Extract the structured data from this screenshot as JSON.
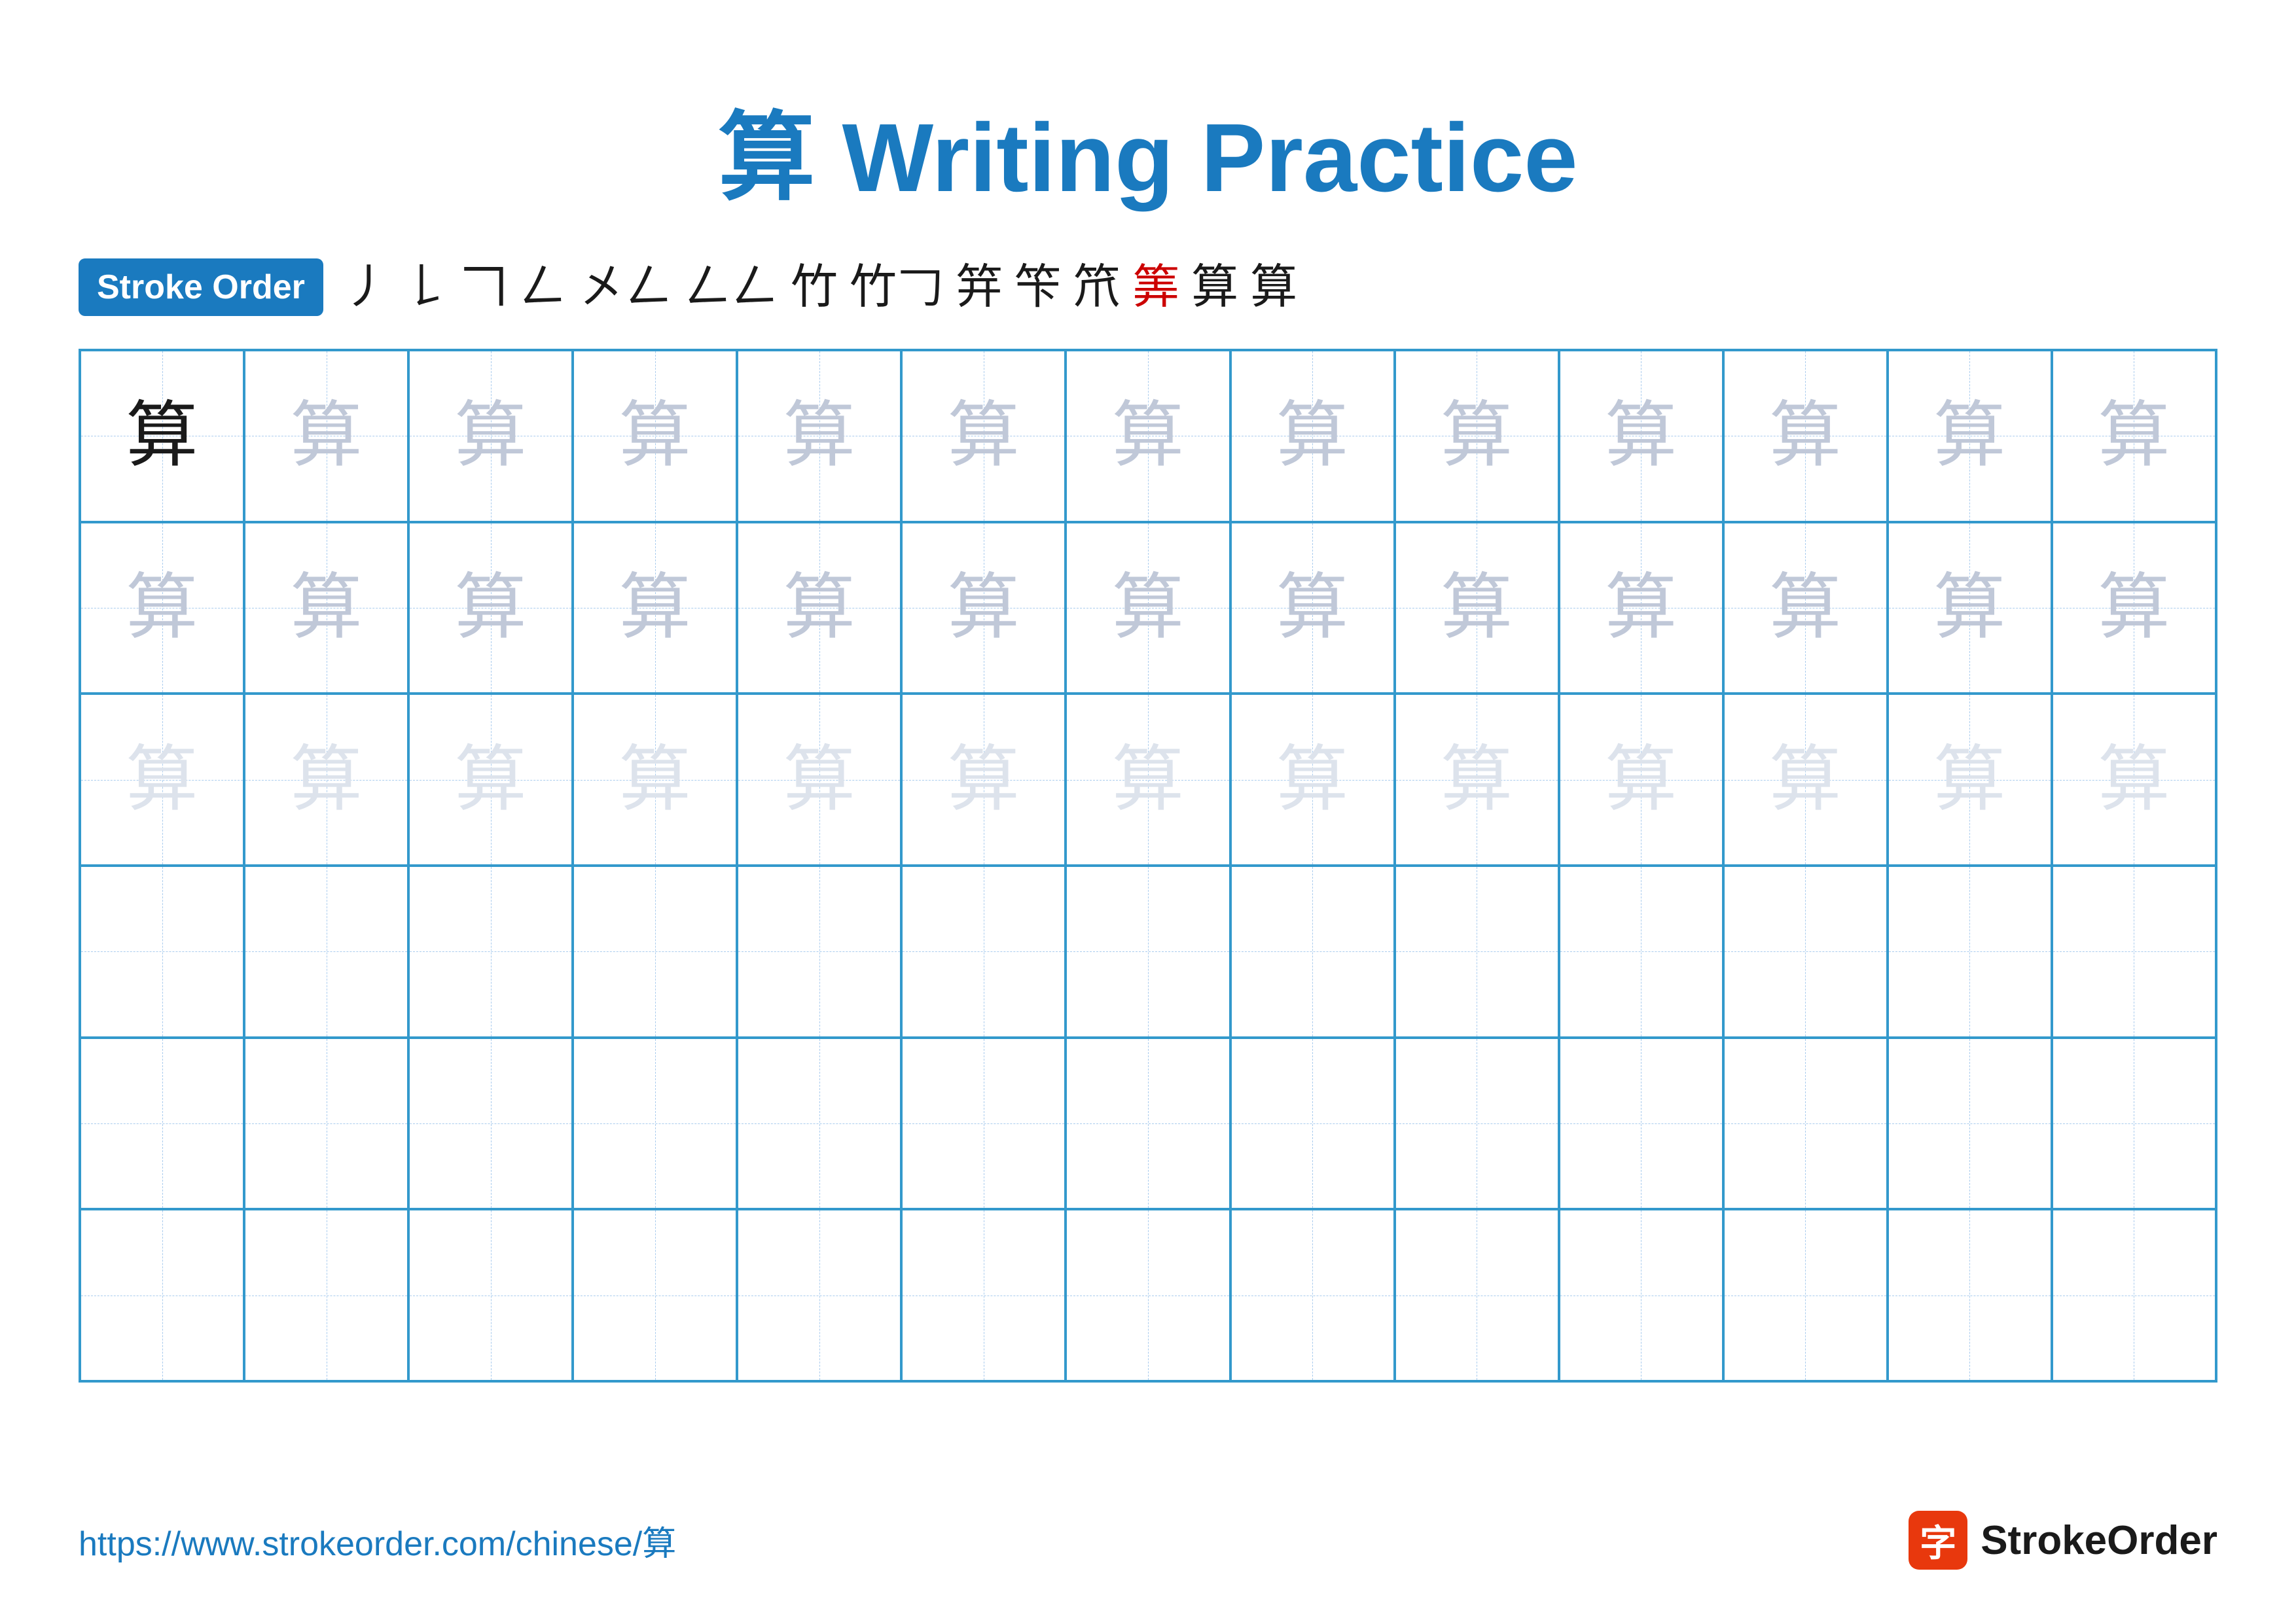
{
  "title": {
    "char": "算",
    "label": " Writing Practice"
  },
  "stroke_order": {
    "badge_label": "Stroke Order",
    "strokes": [
      "丿",
      "𠃌",
      "𠃍",
      "𠃎",
      "𠃏",
      "竹",
      "竹𠃌",
      "笋",
      "笄",
      "笈",
      "笅",
      "筭",
      "算",
      "算"
    ]
  },
  "practice_grid": {
    "rows": 6,
    "cols": 13,
    "char": "算",
    "row_styles": [
      [
        "dark",
        "medium",
        "medium",
        "medium",
        "medium",
        "medium",
        "medium",
        "medium",
        "medium",
        "medium",
        "medium",
        "medium",
        "medium"
      ],
      [
        "medium",
        "medium",
        "medium",
        "medium",
        "medium",
        "medium",
        "medium",
        "medium",
        "medium",
        "medium",
        "medium",
        "medium",
        "medium"
      ],
      [
        "light",
        "light",
        "light",
        "light",
        "light",
        "light",
        "light",
        "light",
        "light",
        "light",
        "light",
        "light",
        "light"
      ],
      [
        "empty",
        "empty",
        "empty",
        "empty",
        "empty",
        "empty",
        "empty",
        "empty",
        "empty",
        "empty",
        "empty",
        "empty",
        "empty"
      ],
      [
        "empty",
        "empty",
        "empty",
        "empty",
        "empty",
        "empty",
        "empty",
        "empty",
        "empty",
        "empty",
        "empty",
        "empty",
        "empty"
      ],
      [
        "empty",
        "empty",
        "empty",
        "empty",
        "empty",
        "empty",
        "empty",
        "empty",
        "empty",
        "empty",
        "empty",
        "empty",
        "empty"
      ]
    ]
  },
  "footer": {
    "url": "https://www.strokeorder.com/chinese/算",
    "logo_char": "字",
    "logo_label": "StrokeOrder"
  }
}
